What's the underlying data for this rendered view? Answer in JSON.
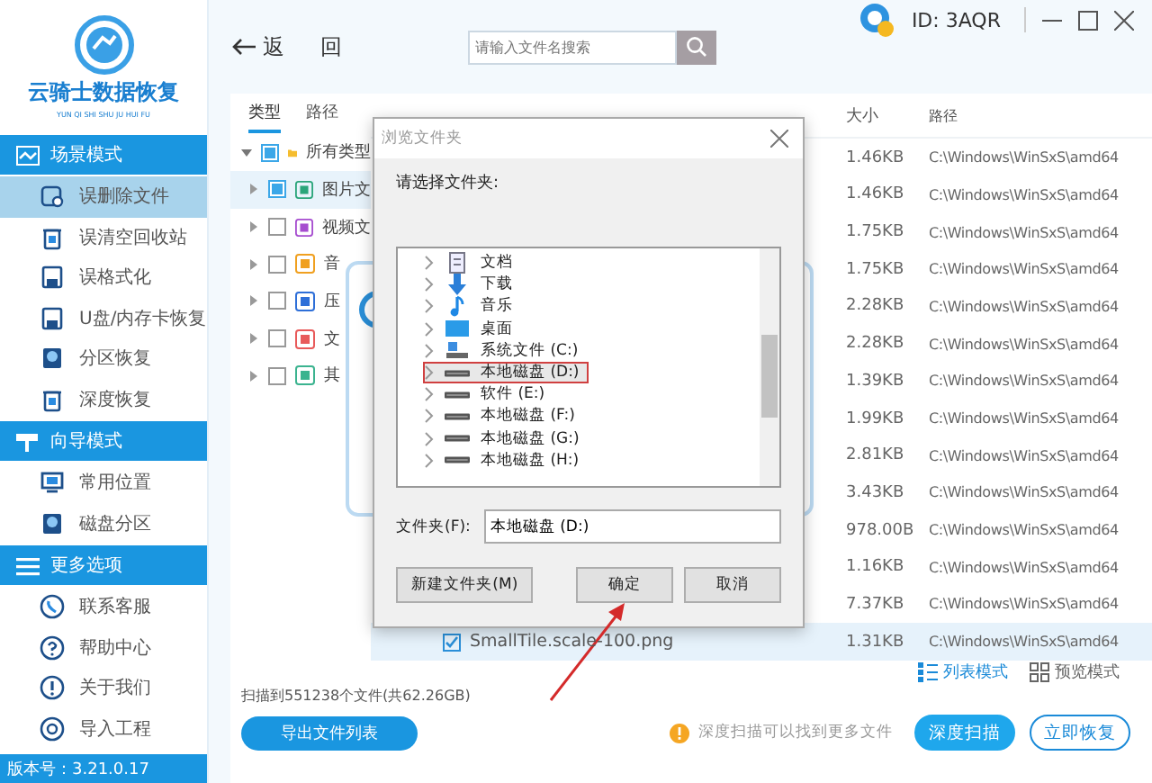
{
  "window": {
    "user_id": "ID: 3AQR"
  },
  "sidebar": {
    "app_name": "云骑士数据恢复",
    "app_subtitle": "YUN QI SHI SHU JU HUI FU",
    "sections": [
      {
        "title": "场景模式",
        "items": [
          {
            "label": "误删除文件",
            "selected": true
          },
          {
            "label": "误清空回收站",
            "selected": false
          },
          {
            "label": "误格式化",
            "selected": false
          },
          {
            "label": "U盘/内存卡恢复",
            "selected": false
          },
          {
            "label": "分区恢复",
            "selected": false
          },
          {
            "label": "深度恢复",
            "selected": false
          }
        ]
      },
      {
        "title": "向导模式",
        "items": [
          {
            "label": "常用位置",
            "selected": false
          },
          {
            "label": "磁盘分区",
            "selected": false
          }
        ]
      },
      {
        "title": "更多选项",
        "items": [
          {
            "label": "联系客服",
            "selected": false
          },
          {
            "label": "帮助中心",
            "selected": false
          },
          {
            "label": "关于我们",
            "selected": false
          },
          {
            "label": "导入工程",
            "selected": false
          }
        ]
      }
    ],
    "version": "版本号：3.21.0.17"
  },
  "toolbar": {
    "back": "返 回",
    "search": {
      "placeholder": "请输入文件名搜索"
    }
  },
  "tree": {
    "tabs": [
      {
        "label": "类型",
        "selected": true
      },
      {
        "label": "路径",
        "selected": false
      }
    ],
    "items": [
      {
        "label": "所有类型",
        "expanded": true,
        "partial": true,
        "selected": false,
        "children": [
          {
            "label": "图片文",
            "expanded": false,
            "partial": true,
            "selected": true
          },
          {
            "label": "视频文",
            "expanded": false,
            "partial": false,
            "selected": false
          },
          {
            "label": "音",
            "expanded": false,
            "partial": false,
            "selected": false
          },
          {
            "label": "压",
            "expanded": false,
            "partial": false,
            "selected": false
          },
          {
            "label": "文",
            "expanded": false,
            "partial": false,
            "selected": false
          },
          {
            "label": "其",
            "expanded": false,
            "partial": false,
            "selected": false
          }
        ]
      }
    ]
  },
  "table": {
    "columns": [
      "大小",
      "路径"
    ],
    "rows": [
      {
        "size": "1.46KB",
        "path": "C:\\Windows\\WinSxS\\amd64",
        "selected": false
      },
      {
        "size": "1.46KB",
        "path": "C:\\Windows\\WinSxS\\amd64",
        "selected": false
      },
      {
        "size": "1.75KB",
        "path": "C:\\Windows\\WinSxS\\amd64",
        "selected": false
      },
      {
        "size": "1.75KB",
        "path": "C:\\Windows\\WinSxS\\amd64",
        "selected": false
      },
      {
        "size": "2.28KB",
        "path": "C:\\Windows\\WinSxS\\amd64",
        "selected": false
      },
      {
        "size": "2.28KB",
        "path": "C:\\Windows\\WinSxS\\amd64",
        "selected": false
      },
      {
        "size": "1.39KB",
        "path": "C:\\Windows\\WinSxS\\amd64",
        "selected": false
      },
      {
        "size": "1.99KB",
        "path": "C:\\Windows\\WinSxS\\amd64",
        "selected": false
      },
      {
        "size": "2.81KB",
        "path": "C:\\Windows\\WinSxS\\amd64",
        "selected": false
      },
      {
        "size": "3.43KB",
        "path": "C:\\Windows\\WinSxS\\amd64",
        "selected": false
      },
      {
        "size": "978.00B",
        "path": "C:\\Windows\\WinSxS\\amd64",
        "selected": false
      },
      {
        "size": "1.16KB",
        "path": "C:\\Windows\\WinSxS\\amd64",
        "selected": false
      },
      {
        "size": "7.37KB",
        "path": "C:\\Windows\\WinSxS\\amd64",
        "selected": false
      },
      {
        "name": "SmallTile.scale-100.png",
        "checked": true,
        "size": "1.31KB",
        "path": "C:\\Windows\\WinSxS\\amd64",
        "selected": true
      }
    ]
  },
  "bottom": {
    "scan_summary": "扫描到551238个文件(共62.26GB)",
    "export_button": "导出文件列表",
    "view_modes": [
      {
        "label": "列表模式",
        "selected": true
      },
      {
        "label": "预览模式",
        "selected": false
      }
    ],
    "hint": "深度扫描可以找到更多文件",
    "buttons": [
      {
        "label": "深度扫描",
        "kind": "primary"
      },
      {
        "label": "立即恢复",
        "kind": "outline"
      }
    ]
  },
  "dialog": {
    "title": "浏览文件夹",
    "prompt": "请选择文件夹:",
    "folders": [
      {
        "label": "文档",
        "kind": "document",
        "selected": false
      },
      {
        "label": "下载",
        "kind": "download",
        "selected": false
      },
      {
        "label": "音乐",
        "kind": "music",
        "selected": false
      },
      {
        "label": "桌面",
        "kind": "desktop",
        "selected": false
      },
      {
        "label": "系统文件 (C:)",
        "kind": "system-drive",
        "selected": false
      },
      {
        "label": "本地磁盘 (D:)",
        "kind": "drive",
        "selected": true
      },
      {
        "label": "软件 (E:)",
        "kind": "drive",
        "selected": false
      },
      {
        "label": "本地磁盘 (F:)",
        "kind": "drive",
        "selected": false
      },
      {
        "label": "本地磁盘 (G:)",
        "kind": "drive",
        "selected": false
      },
      {
        "label": "本地磁盘 (H:)",
        "kind": "drive",
        "selected": false
      }
    ],
    "folder_label": "文件夹(F):",
    "folder_value": "本地磁盘 (D:)",
    "buttons": [
      "新建文件夹(M)",
      "确定",
      "取消"
    ]
  }
}
